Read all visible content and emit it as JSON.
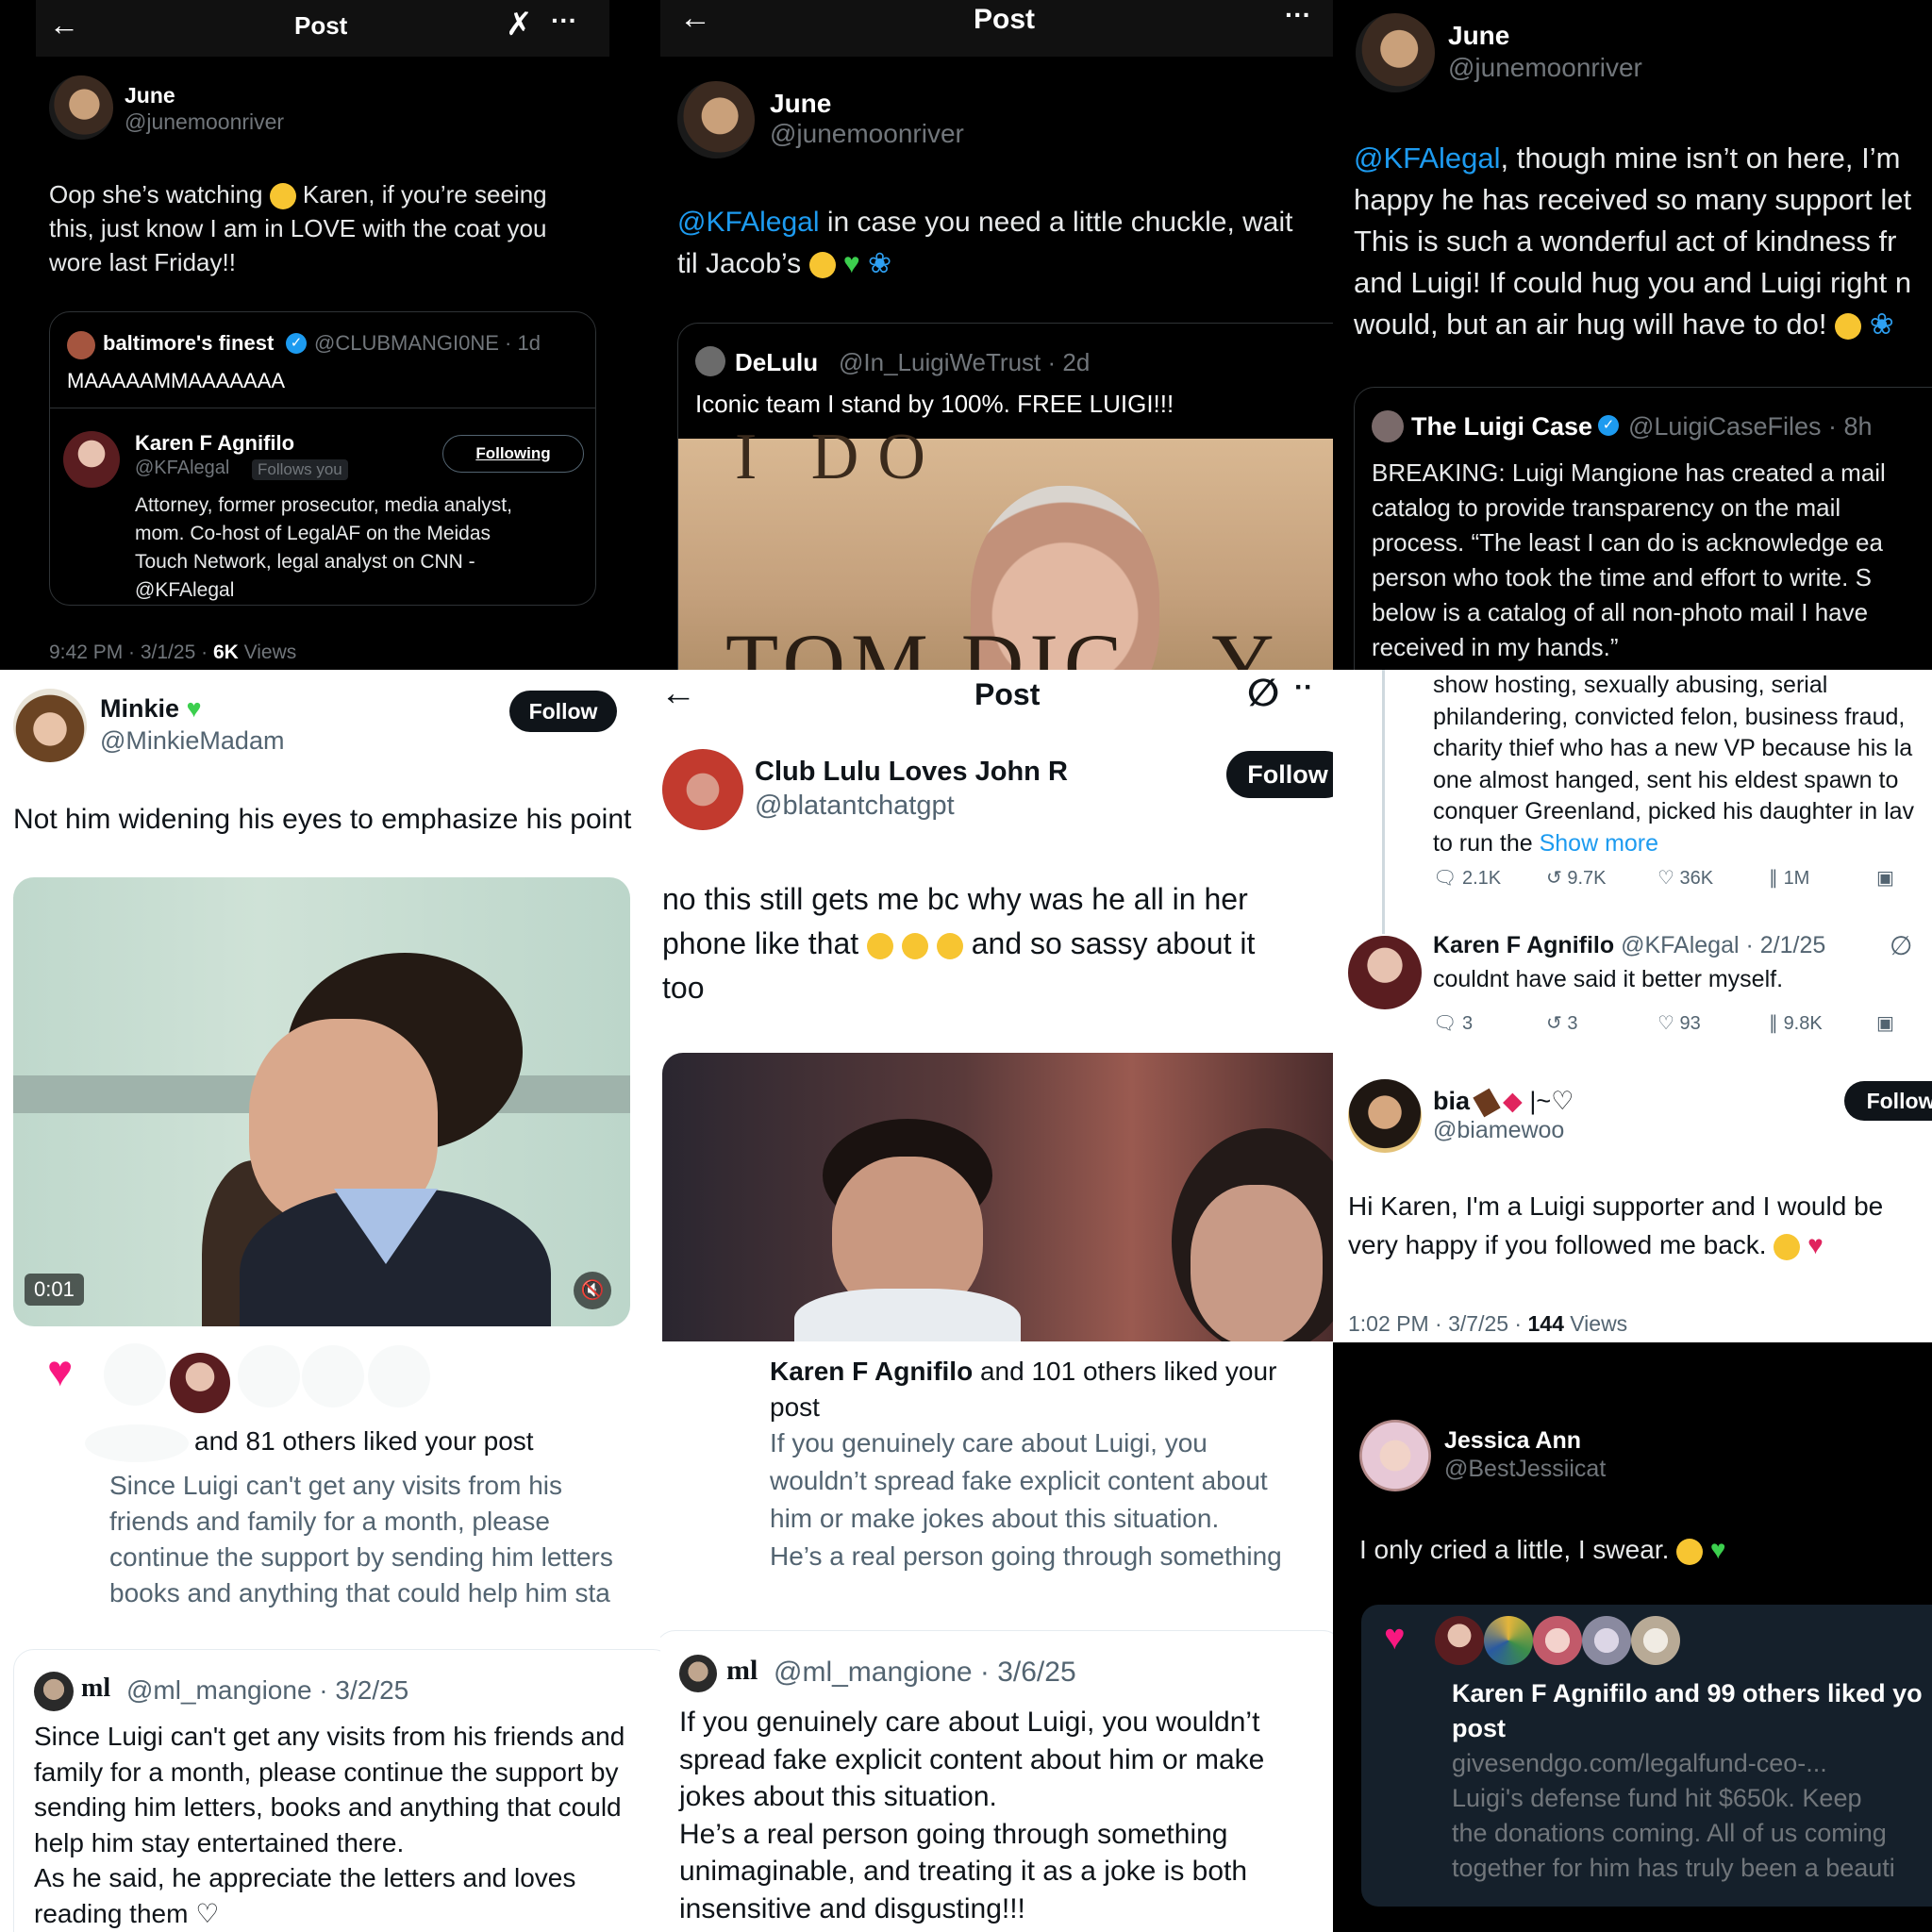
{
  "panel1": {
    "nav_title": "Post",
    "author_name": "June",
    "author_handle": "@junemoonriver",
    "body_line1": "Oop she’s watching",
    "body_line1b": "Karen, if you’re seeing",
    "body_line2": "this, just know I am in LOVE with the coat you",
    "body_line3": "wore last Friday!!",
    "quote_name": "baltimore's finest",
    "quote_handle": "@CLUBMANGI0NE · 1d",
    "quote_text": "MAAAAAMMAAAAAAA",
    "profile_name": "Karen F Agnifilo",
    "profile_handle": "@KFAlegal",
    "profile_follows": "Follows you",
    "profile_button": "Following",
    "profile_bio1": "Attorney, former prosecutor, media analyst,",
    "profile_bio2": "mom. Co-host of LegalAF on the Meidas",
    "profile_bio3": "Touch Network, legal analyst on CNN -",
    "profile_bio4": "@KFAlegal",
    "meta_time": "9:42 PM · 3/1/25 ·",
    "meta_views_num": "6K",
    "meta_views_label": "Views"
  },
  "panel2": {
    "nav_title": "Post",
    "author_name": "June",
    "author_handle": "@junemoonriver",
    "mention": "@KFAlegal",
    "body_line1": "in case you need a little chuckle, wait",
    "body_line2": "til Jacob’s",
    "quote_name": "DeLulu",
    "quote_handle": "@In_LuigiWeTrust · 2d",
    "quote_text": "Iconic team I stand by 100%. FREE LUIGI!!!",
    "image_sign": "TOM DIC",
    "image_sign_tail": "Y L"
  },
  "panel3": {
    "author_name": "June",
    "author_handle": "@junemoonriver",
    "mention": "@KFAlegal",
    "body_line1": ", though mine isn’t on here, I’m",
    "body_line2": "happy he has received so many support let",
    "body_line3": "This is such a wonderful act of kindness fr",
    "body_line4": "and Luigi! If could hug you and Luigi right n",
    "body_line5": "would, but an air hug will have to do!",
    "quote_name": "The Luigi Case",
    "quote_handle": "@LuigiCaseFiles · 8h",
    "quote_line1": "BREAKING: Luigi Mangione has created a mail",
    "quote_line2": "catalog to provide transparency on the mail",
    "quote_line3": "process. “The least I can do is acknowledge ea",
    "quote_line4": "person who took the time and effort to write. S",
    "quote_line5": "below is a catalog of all non-photo mail I have",
    "quote_line6": "received in my hands.”"
  },
  "panel4": {
    "author_name": "Minkie",
    "author_handle": "@MinkieMadam",
    "follow_label": "Follow",
    "body": "Not him widening his eyes to emphasize his point",
    "video_time": "0:01",
    "notif_text": "and 81 others liked your post",
    "notif_preview1": "Since Luigi can't get any visits from his",
    "notif_preview2": "friends and family for a month, please",
    "notif_preview3": "continue the support by sending him letters",
    "notif_preview4": "books and anything that could help him sta"
  },
  "panel5": {
    "nav_title": "Post",
    "author_name": "Club Lulu Loves John R",
    "author_handle": "@blatantchatgpt",
    "follow_label": "Follow",
    "body_line1": "no this still gets me bc why was he all in her",
    "body_line2a": "phone like that",
    "body_line2b": "and so sassy about it",
    "body_line3": "too",
    "notif_name": "Karen F Agnifilo",
    "notif_text": "and 101 others liked your",
    "notif_text2": "post",
    "notif_preview1": "If you genuinely care about Luigi, you",
    "notif_preview2": "wouldn’t spread fake explicit content about",
    "notif_preview3": "him or make jokes about this situation.",
    "notif_preview4": "He’s a real person going through something"
  },
  "panel6": {
    "tail_line1": "show hosting, sexually abusing, serial",
    "tail_line2": "philandering, convicted felon, business fraud,",
    "tail_line3": "charity thief who has a new VP because his la",
    "tail_line4": "one almost hanged, sent his eldest spawn to",
    "tail_line5": "conquer Greenland, picked his daughter in lav",
    "tail_line6": "to run the",
    "show_more": "Show more",
    "stats1": {
      "replies": "2.1K",
      "reposts": "9.7K",
      "likes": "36K",
      "views": "1M"
    },
    "reply_name": "Karen F Agnifilo",
    "reply_handle": "@KFAlegal · 2/1/25",
    "reply_text": "couldnt have said it better myself.",
    "stats2": {
      "replies": "3",
      "reposts": "3",
      "likes": "93",
      "views": "9.8K"
    },
    "bia_name": "bia",
    "bia_name_tail": "|~♡",
    "bia_handle": "@biamewoo",
    "follow_label": "Follow",
    "bia_line1": "Hi Karen, I'm a Luigi supporter and I would be",
    "bia_line2": "very happy if you followed me back.",
    "meta_time": "1:02 PM · 3/7/25 ·",
    "meta_views_num": "144",
    "meta_views_label": "Views"
  },
  "panel7": {
    "author_name": "ml",
    "author_handle": "@ml_mangione · 3/2/25",
    "line1": "Since Luigi can't get any visits from his friends and",
    "line2": "family for a month, please continue the support by",
    "line3": "sending him letters, books and anything that could",
    "line4": "help him stay entertained there.",
    "line5": "As he said, he appreciate the letters and loves",
    "line6": "reading them ♡"
  },
  "panel8": {
    "author_name": "ml",
    "author_handle": "@ml_mangione · 3/6/25",
    "line1": "If you genuinely care about Luigi, you wouldn’t",
    "line2": "spread fake explicit content about him or make",
    "line3": "jokes about this situation.",
    "line4": "He’s a real person going through something",
    "line5": "unimaginable, and treating it as a joke is both",
    "line6": "insensitive and disgusting!!!"
  },
  "panel9": {
    "author_name": "Jessica Ann",
    "author_handle": "@BestJessiicat",
    "body": "I only cried a little, I swear.",
    "notif_text1": "Karen F Agnifilo and 99 others liked yo",
    "notif_text2": "post",
    "notif_link": "givesendgo.com/legalfund-ceo-...",
    "notif_line1": "Luigi's defense fund hit $650k. Keep",
    "notif_line2": "the donations coming. All of us coming",
    "notif_line3": "together for him has truly been a beauti"
  },
  "colors": {
    "accent": "#1d9bf0",
    "like_pink": "#f91880",
    "green_heart": "#3ccf4e"
  }
}
